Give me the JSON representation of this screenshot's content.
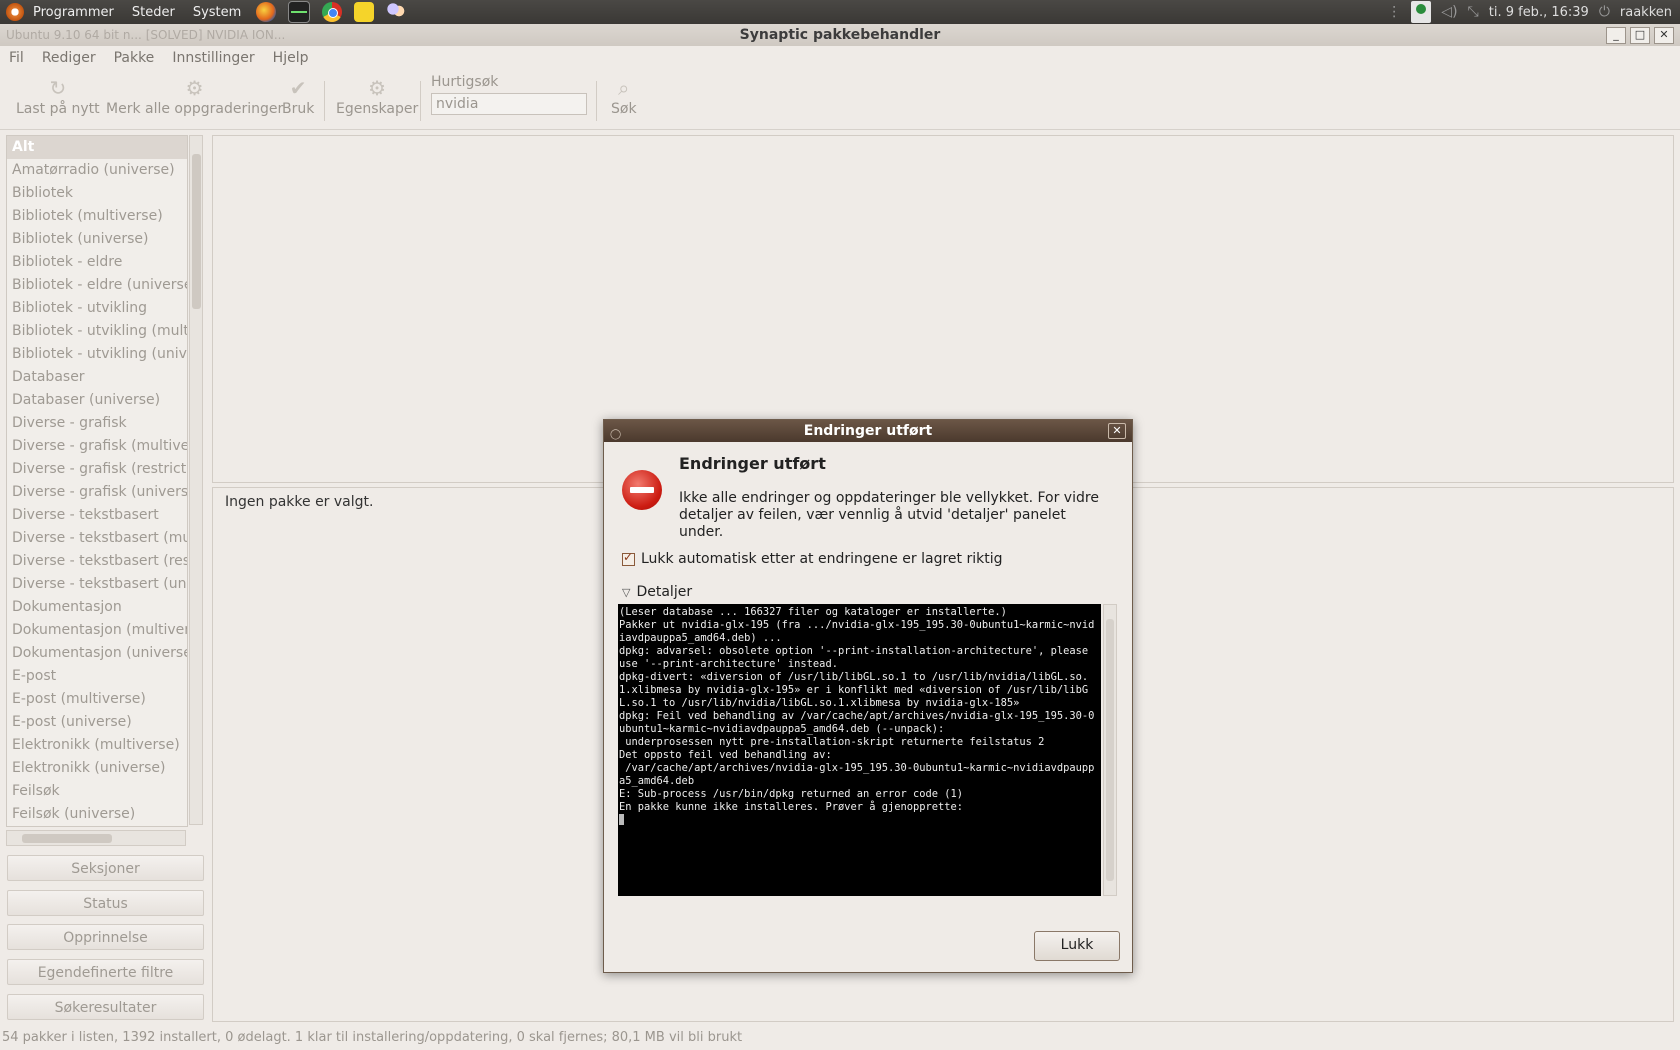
{
  "top_panel": {
    "menus": [
      "Programmer",
      "Steder",
      "System"
    ],
    "clock": "ti. 9 feb., 16:39",
    "user": "raakken"
  },
  "window": {
    "title": "Synaptic pakkebehandler",
    "background_tabs": "Ubuntu 9.10 64 bit n...     [SOLVED] NVIDIA ION..."
  },
  "menubar": {
    "items": [
      "Fil",
      "Rediger",
      "Pakke",
      "Innstillinger",
      "Hjelp"
    ]
  },
  "toolbar": {
    "reload": "Last på nytt",
    "mark_all": "Merk alle oppgraderinger",
    "apply": "Bruk",
    "properties": "Egenskaper",
    "quicksearch_label": "Hurtigsøk",
    "quicksearch_value": "nvidia",
    "search": "Søk"
  },
  "sections": [
    "Alt",
    "Amatørradio (universe)",
    "Bibliotek",
    "Bibliotek (multiverse)",
    "Bibliotek (universe)",
    "Bibliotek - eldre",
    "Bibliotek - eldre (universe)",
    "Bibliotek - utvikling",
    "Bibliotek - utvikling (multiverse)",
    "Bibliotek - utvikling (universe)",
    "Databaser",
    "Databaser (universe)",
    "Diverse - grafisk",
    "Diverse - grafisk (multiverse)",
    "Diverse - grafisk (restricted)",
    "Diverse - grafisk (universe)",
    "Diverse - tekstbasert",
    "Diverse - tekstbasert (multiverse)",
    "Diverse - tekstbasert (restricted)",
    "Diverse - tekstbasert (universe)",
    "Dokumentasjon",
    "Dokumentasjon (multiverse)",
    "Dokumentasjon (universe)",
    "E-post",
    "E-post (multiverse)",
    "E-post (universe)",
    "Elektronikk (multiverse)",
    "Elektronikk (universe)",
    "Feilsøk",
    "Feilsøk (universe)"
  ],
  "filters": {
    "sections": "Seksjoner",
    "status": "Status",
    "origin": "Opprinnelse",
    "custom": "Egendefinerte filtre",
    "search_results": "Søkeresultater"
  },
  "details_text": "Ingen pakke er valgt.",
  "statusbar": "54 pakker i listen, 1392 installert, 0 ødelagt. 1 klar til installering/oppdatering, 0 skal fjernes; 80,1 MB vil bli brukt",
  "dialog": {
    "title": "Endringer utført",
    "heading": "Endringer utført",
    "message": "Ikke alle endringer og oppdateringer ble vellykket. For vidre detaljer av feilen, vær vennlig å utvid 'detaljer' panelet under.",
    "auto_close": "Lukk automatisk etter at endringene er lagret riktig",
    "details_label": "Detaljer",
    "close_button": "Lukk",
    "terminal_lines": [
      "(Leser database ... 166327 filer og kataloger er installerte.)",
      "Pakker ut nvidia-glx-195 (fra .../nvidia-glx-195_195.30-0ubuntu1~karmic~nvidiavdpauppa5_amd64.deb) ...",
      "dpkg: advarsel: obsolete option '--print-installation-architecture', please use '--print-architecture' instead.",
      "dpkg-divert: «diversion of /usr/lib/libGL.so.1 to /usr/lib/nvidia/libGL.so.1.xlibmesa by nvidia-glx-195» er i konflikt med «diversion of /usr/lib/libGL.so.1 to /usr/lib/nvidia/libGL.so.1.xlibmesa by nvidia-glx-185»",
      "dpkg: Feil ved behandling av /var/cache/apt/archives/nvidia-glx-195_195.30-0ubuntu1~karmic~nvidiavdpauppa5_amd64.deb (--unpack):",
      " underprosessen nytt pre-installation-skript returnerte feilstatus 2",
      "Det oppsto feil ved behandling av:",
      " /var/cache/apt/archives/nvidia-glx-195_195.30-0ubuntu1~karmic~nvidiavdpauppa5_amd64.deb",
      "E: Sub-process /usr/bin/dpkg returned an error code (1)",
      "En pakke kunne ikke installeres. Prøver å gjenopprette:"
    ]
  }
}
